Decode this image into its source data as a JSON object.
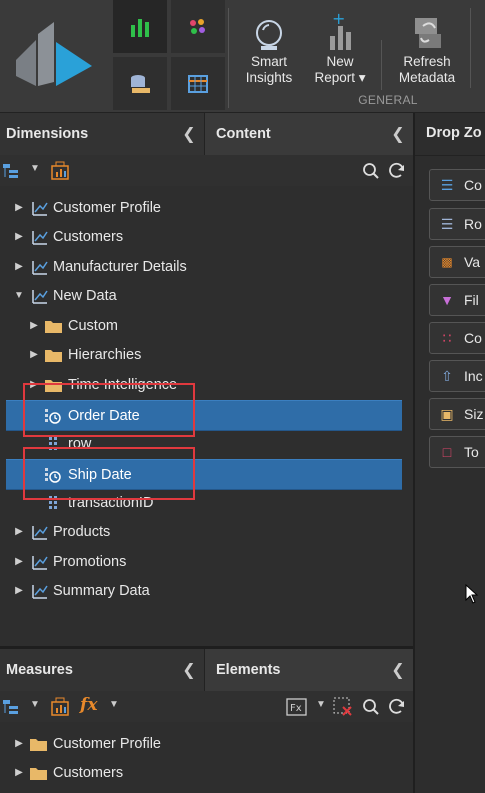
{
  "ribbon": {
    "smart_insights": "Smart\nInsights",
    "new_report": "New\nReport ▾",
    "refresh_metadata": "Refresh\nMetadata",
    "group_label": "GENERAL"
  },
  "dimensions_panel": {
    "tab_dimensions": "Dimensions",
    "tab_content": "Content",
    "tree": [
      {
        "label": "Customer Profile"
      },
      {
        "label": "Customers"
      },
      {
        "label": "Manufacturer Details"
      },
      {
        "label": "New Data"
      },
      {
        "label": "Custom"
      },
      {
        "label": "Hierarchies"
      },
      {
        "label": "Time Intelligence"
      },
      {
        "label": "Order Date"
      },
      {
        "label": "row"
      },
      {
        "label": "Ship Date"
      },
      {
        "label": "transactionID"
      },
      {
        "label": "Products"
      },
      {
        "label": "Promotions"
      },
      {
        "label": "Summary Data"
      }
    ]
  },
  "measures_panel": {
    "tab_measures": "Measures",
    "tab_elements": "Elements",
    "tree": [
      {
        "label": "Customer Profile"
      },
      {
        "label": "Customers"
      }
    ]
  },
  "drop_zones": {
    "title": "Drop Zo",
    "zones": [
      {
        "label": "Co"
      },
      {
        "label": "Ro"
      },
      {
        "label": "Va"
      },
      {
        "label": "Fil"
      },
      {
        "label": "Co"
      },
      {
        "label": "Inc"
      },
      {
        "label": "Siz"
      },
      {
        "label": "To"
      }
    ]
  },
  "colors": {
    "selection": "#2f6da8",
    "highlight_box": "#e0393e",
    "folder": "#e8b868",
    "accent_green": "#2fbf4a",
    "accent_orange": "#e8892b"
  }
}
